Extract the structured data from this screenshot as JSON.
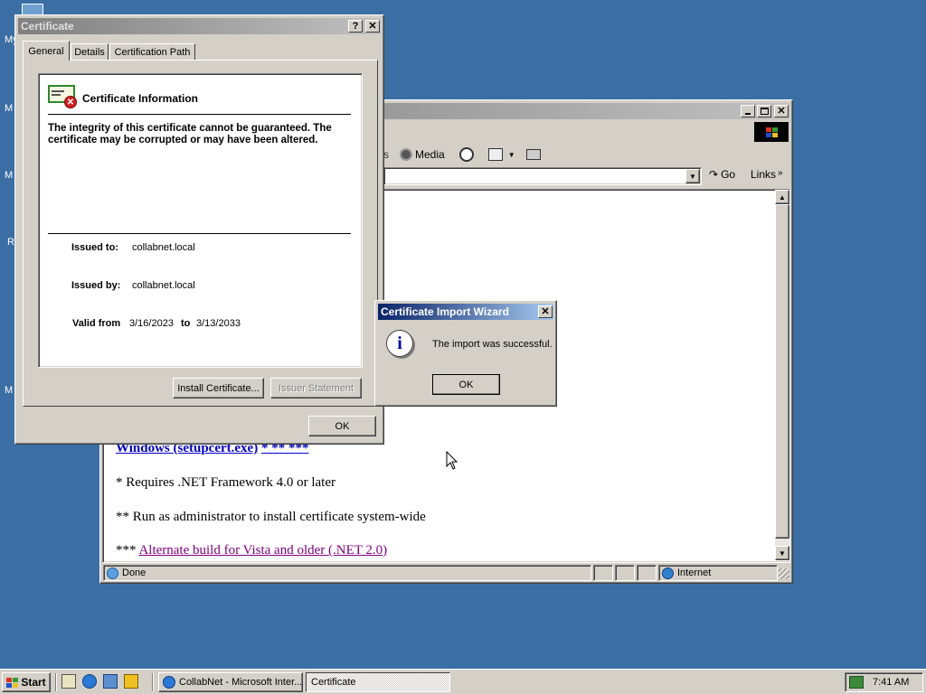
{
  "desktop": {
    "icon_labels": [
      "My",
      "M",
      "M",
      "R",
      "M"
    ]
  },
  "browser": {
    "toolbar": {
      "partial_left": "s",
      "media_label": "Media"
    },
    "address": {
      "go_label": "Go",
      "links_label": "Links"
    },
    "content": {
      "line1_link": "Windows (setupcert.exe)",
      "line1_suffix": "* ** ***",
      "line2": "* Requires .NET Framework 4.0 or later",
      "line3": "** Run as administrator to install certificate system-wide",
      "line4_prefix": "***",
      "line4_link": "Alternate build for Vista and older (.NET 2.0)"
    },
    "status": {
      "text": "Done",
      "zone": "Internet"
    }
  },
  "cert_dialog": {
    "title": "Certificate",
    "help_btn": "?",
    "close_btn": "✕",
    "tabs": [
      {
        "label": "General"
      },
      {
        "label": "Details"
      },
      {
        "label": "Certification Path"
      }
    ],
    "info_heading": "Certificate Information",
    "warning": "The integrity of this certificate cannot be guaranteed. The certificate may be corrupted or may have been altered.",
    "issued_to_label": "Issued to:",
    "issued_to_value": "collabnet.local",
    "issued_by_label": "Issued by:",
    "issued_by_value": "collabnet.local",
    "valid_from_label": "Valid from",
    "valid_from_value": "3/16/2023",
    "valid_to_label": "to",
    "valid_to_value": "3/13/2033",
    "install_btn": "Install Certificate...",
    "issuer_btn": "Issuer Statement",
    "ok_btn": "OK"
  },
  "wizard_dialog": {
    "title": "Certificate Import Wizard",
    "close_btn": "✕",
    "message": "The import was successful.",
    "ok_btn": "OK"
  },
  "taskbar": {
    "start_label": "Start",
    "tasks": [
      {
        "label": "CollabNet - Microsoft Inter..."
      },
      {
        "label": "Certificate"
      }
    ],
    "clock": "7:41 AM"
  }
}
